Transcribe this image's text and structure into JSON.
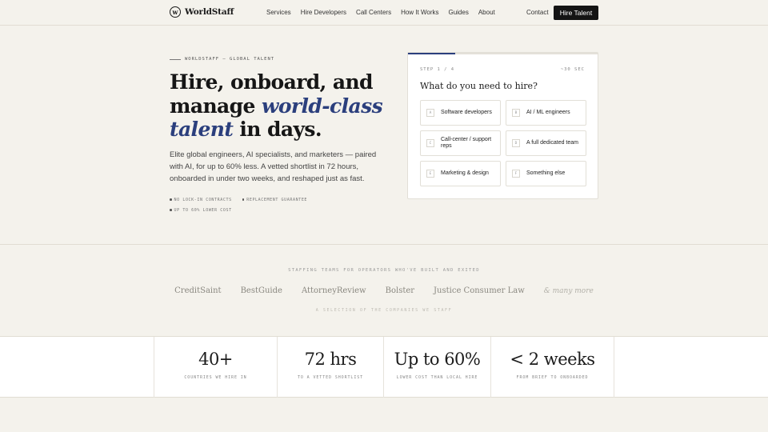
{
  "header": {
    "brand": "WorldStaff",
    "brand_mark": "w",
    "nav": [
      "Services",
      "Hire Developers",
      "Call Centers",
      "How It Works",
      "Guides",
      "About"
    ],
    "contact": "Contact",
    "cta": "Hire Talent"
  },
  "hero": {
    "eyebrow": "WORLDSTAFF — GLOBAL TALENT",
    "headline_1": "Hire, onboard, and manage ",
    "headline_em": "world-class talent",
    "headline_2": " in days.",
    "subtitle": "Elite global engineers, AI specialists, and marketers — paired with AI, for up to 60% less. A vetted shortlist in 72 hours, onboarded in under two weeks, and reshaped just as fast.",
    "chips": [
      "NO LOCK-IN CONTRACTS",
      "REPLACEMENT GUARANTEE",
      "UP TO 60% LOWER COST"
    ]
  },
  "quiz": {
    "step": "STEP 1 / 4",
    "time": "~30 SEC",
    "progress": 0.25,
    "question": "What do you need to hire?",
    "options": [
      {
        "key": "A",
        "label": "Software developers"
      },
      {
        "key": "B",
        "label": "AI / ML engineers"
      },
      {
        "key": "C",
        "label": "Call-center / support reps"
      },
      {
        "key": "D",
        "label": "A full dedicated team"
      },
      {
        "key": "E",
        "label": "Marketing & design"
      },
      {
        "key": "F",
        "label": "Something else"
      }
    ]
  },
  "logos": {
    "title": "STAFFING TEAMS FOR OPERATORS WHO'VE BUILT AND EXITED",
    "brands": [
      "CreditSaint",
      "BestGuide",
      "AttorneyReview",
      "Bolster",
      "Justice Consumer Law"
    ],
    "more": "& many more",
    "note": "A SELECTION OF THE COMPANIES WE STAFF"
  },
  "stats": [
    {
      "value": "40+",
      "label": "COUNTRIES WE HIRE IN"
    },
    {
      "value": "72 hrs",
      "label": "TO A VETTED SHORTLIST"
    },
    {
      "value": "Up to 60%",
      "label": "LOWER COST THAN LOCAL HIRE"
    },
    {
      "value": "< 2 weeks",
      "label": "FROM BRIEF TO ONBOARDED"
    }
  ]
}
